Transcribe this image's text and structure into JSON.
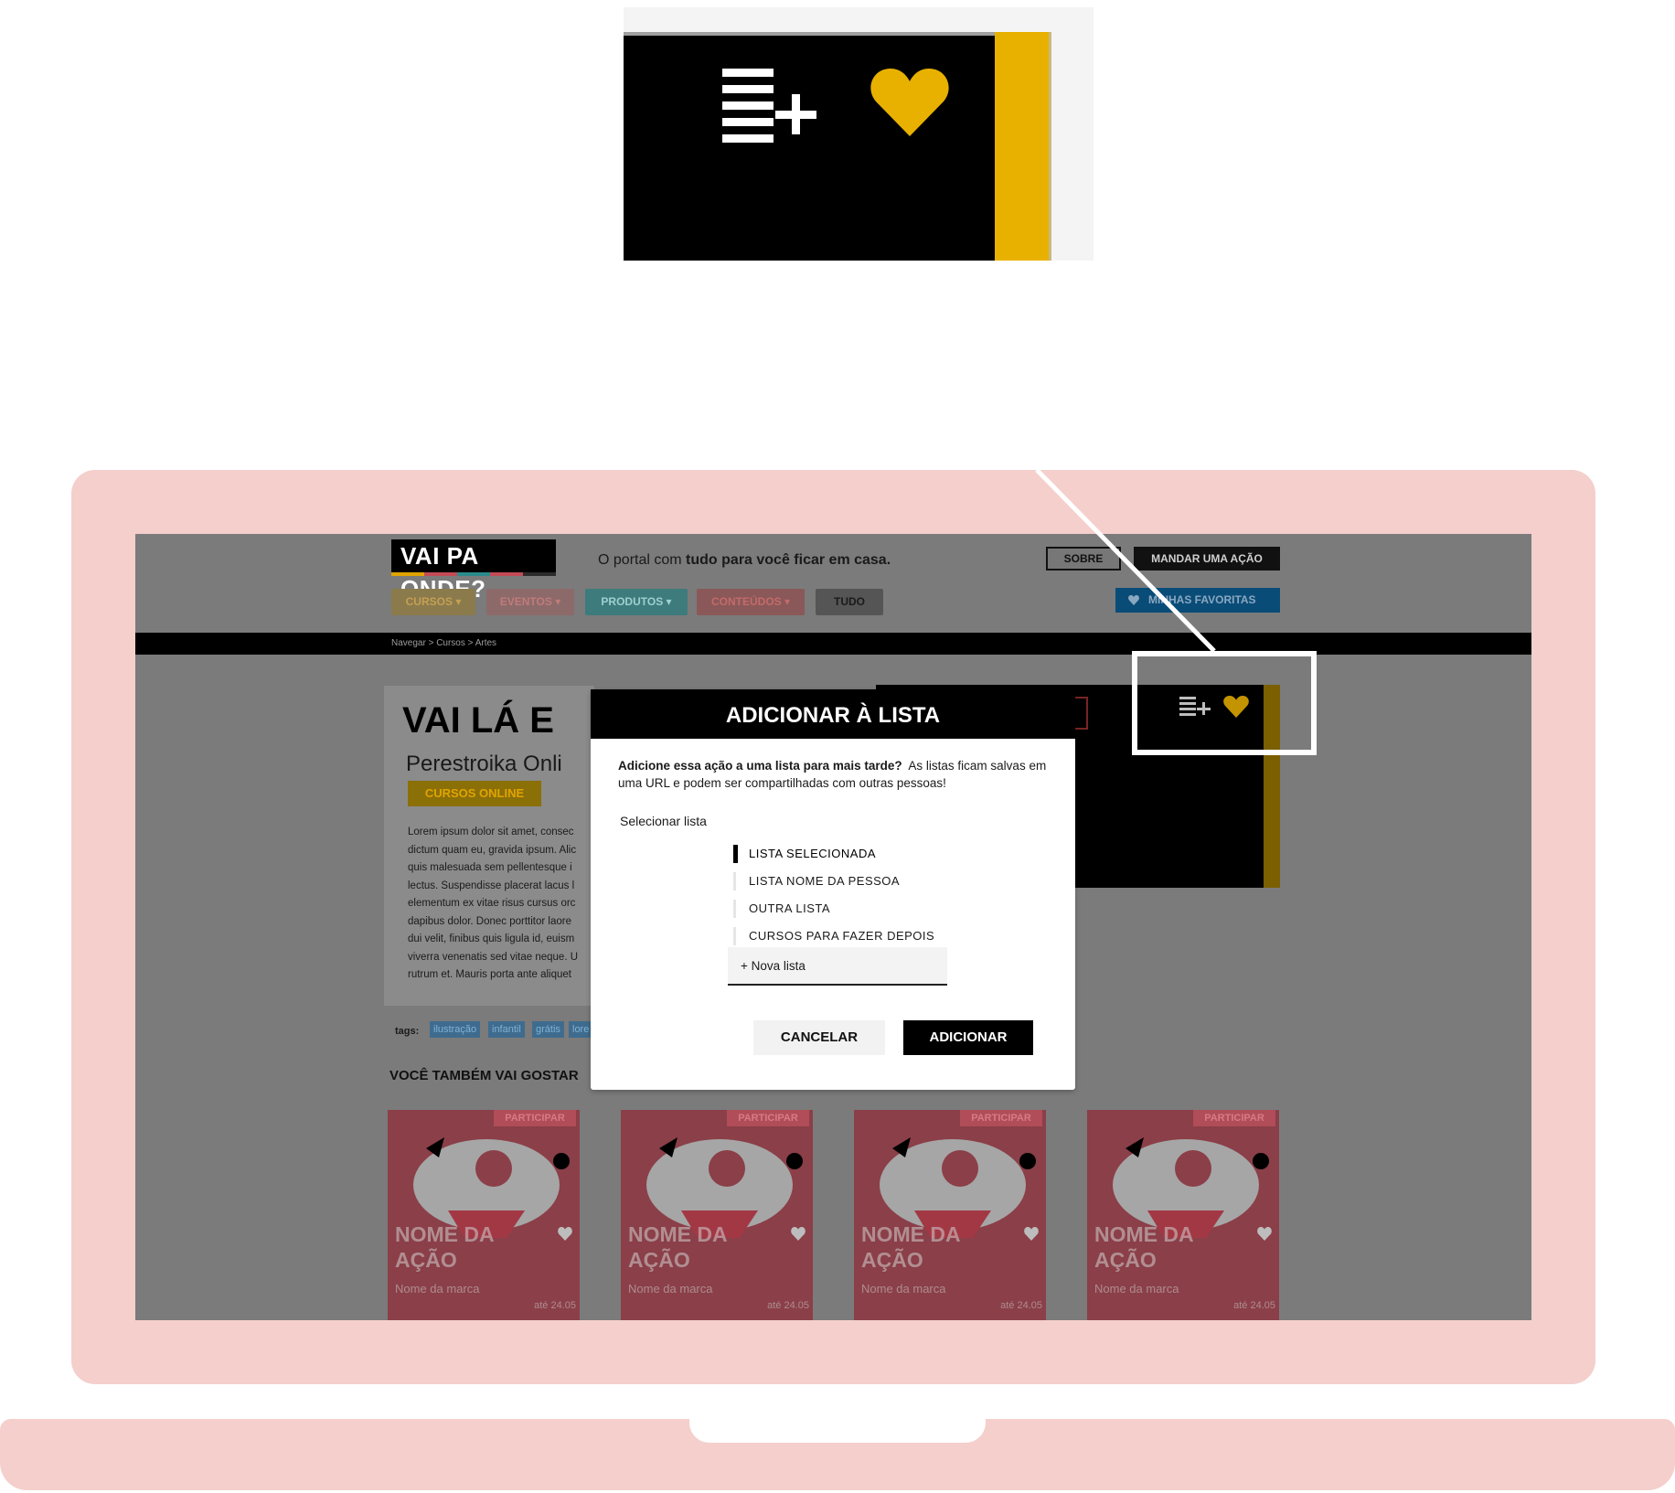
{
  "site": {
    "logo": "VAI PA ONDE?",
    "tagline_pre": "O portal com",
    "tagline_bold": "tudo para você ficar em casa.",
    "logo_stripes": [
      "#e0a400",
      "#c34a56",
      "#2b8a8b",
      "#c34a56",
      "#2b2b2b"
    ]
  },
  "header": {
    "sobre": "SOBRE",
    "mandar": "MANDAR UMA AÇÃO",
    "favoritas": "MINHAS FAVORITAS"
  },
  "nav": {
    "cursos": "CURSOS ▾",
    "eventos": "EVENTOS ▾",
    "produtos": "PRODUTOS ▾",
    "conteudos": "CONTEÚDOS ▾",
    "tudo": "TUDO"
  },
  "breadcrumb": "Navegar  >  Cursos  >  Artes",
  "page": {
    "title": "VAI LÁ E",
    "subtitle": "Perestroika Onli",
    "category": "CURSOS ONLINE",
    "lorem": [
      "Lorem ipsum dolor sit amet, consec",
      "dictum quam eu, gravida ipsum. Alic",
      "quis malesuada sem pellentesque i",
      "lectus. Suspendisse placerat lacus l",
      "elementum ex vitae risus cursus orc",
      "dapibus dolor. Donec porttitor laore",
      "dui velit, finibus quis ligula id, euism",
      "viverra venenatis sed vitae neque. U",
      "rutrum et. Mauris porta ante aliquet"
    ],
    "tags_label": "tags:",
    "tags": [
      "ilustração",
      "infantil",
      "grátis",
      "lore"
    ],
    "related_title": "VOCÊ TAMBÉM VAI GOSTAR"
  },
  "cards": [
    {
      "tab": "PARTICIPAR",
      "name_1": "NOME DA",
      "name_2": "AÇÃO",
      "brand": "Nome da marca",
      "date": "até 24.05"
    },
    {
      "tab": "PARTICIPAR",
      "name_1": "NOME DA",
      "name_2": "AÇÃO",
      "brand": "Nome da marca",
      "date": "até 24.05"
    },
    {
      "tab": "PARTICIPAR",
      "name_1": "NOME DA",
      "name_2": "AÇÃO",
      "brand": "Nome da marca",
      "date": "até 24.05"
    },
    {
      "tab": "PARTICIPAR",
      "name_1": "NOME DA",
      "name_2": "AÇÃO",
      "brand": "Nome da marca",
      "date": "até 24.05"
    }
  ],
  "modal": {
    "title": "ADICIONAR À LISTA",
    "desc_bold": "Adicione essa ação a uma lista para mais tarde?",
    "desc_rest": "As listas ficam salvas em uma URL e podem ser compartilhadas com outras pessoas!",
    "select_label": "Selecionar lista",
    "options": [
      "LISTA SELECIONADA",
      "LISTA NOME DA PESSOA",
      "OUTRA LISTA",
      "CURSOS PARA FAZER DEPOIS"
    ],
    "new_list": "+ Nova lista",
    "cancel": "CANCELAR",
    "add": "ADICIONAR"
  },
  "icons": {
    "add_to_list": "list-plus-icon",
    "favorite": "heart-icon"
  },
  "colors": {
    "accent_yellow": "#e8b100",
    "laptop_pink": "#f4cfcc",
    "card_red": "#c34a56"
  }
}
